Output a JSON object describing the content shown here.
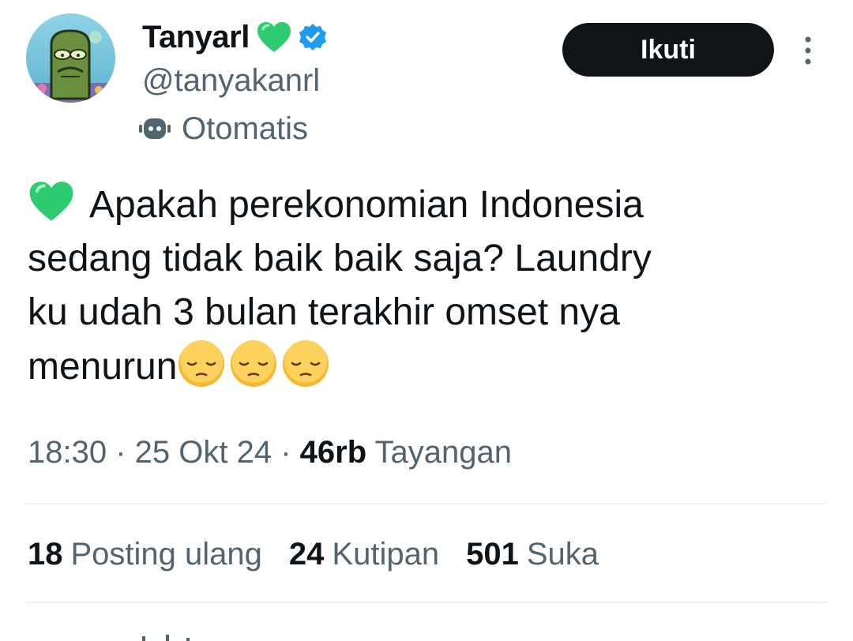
{
  "user": {
    "display_name": "Tanyarl",
    "handle": "@tanyakanrl",
    "automated_label": "Otomatis",
    "name_emoji": "green-heart",
    "verified_badge_color": "#1d9bf0"
  },
  "actions": {
    "follow_label": "Ikuti",
    "more_icon": "more-vertical-icon"
  },
  "tweet": {
    "lines": [
      "Apakah  perekonomian Indonesia",
      "sedang tidak baik baik saja? Laundry",
      "ku udah 3 bulan terakhir omset nya",
      "menurun"
    ],
    "leading_emoji": "green-heart",
    "trailing_emoji": [
      "pensive-face",
      "pensive-face",
      "pensive-face"
    ]
  },
  "meta": {
    "time": "18:30",
    "separator": " · ",
    "date": "25 Okt 24",
    "views_count": "46rb",
    "views_label": "Tayangan"
  },
  "stats": {
    "reposts": {
      "count": "18",
      "label": "Posting ulang"
    },
    "quotes": {
      "count": "24",
      "label": "Kutipan"
    },
    "likes": {
      "count": "501",
      "label": "Suka"
    }
  },
  "colors": {
    "text": "#0f1419",
    "secondary": "#536471",
    "divider": "#eff3f4",
    "heart": "#2ecc71",
    "verified": "#1d9bf0",
    "button": "#0f1419"
  }
}
